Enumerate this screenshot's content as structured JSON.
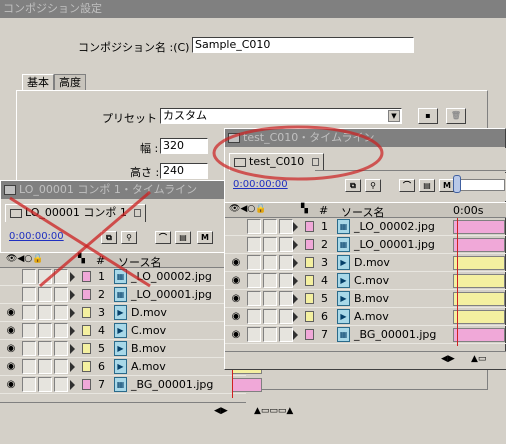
{
  "dialog": {
    "title": "コンポジション設定",
    "name_label": "コンポジション名 :(C)",
    "name_value": "Sample_C010",
    "tabs": [
      "基本",
      "高度"
    ],
    "preset_label": "プリセット :",
    "preset_value": "カスタム",
    "width_label": "幅 :",
    "width_value": "320",
    "height_label": "高さ :",
    "height_value": "240"
  },
  "timeline_front": {
    "title": "test_C010・タイムライン",
    "tab": "test_C010",
    "timecode": "0:00:00:00",
    "ruler_label": "0:00s",
    "col_number": "#",
    "col_source": "ソース名",
    "layers": [
      {
        "num": "1",
        "name": "_LO_00002.jpg",
        "color": "#f0a8d8",
        "type": "jpg",
        "visible": false
      },
      {
        "num": "2",
        "name": "_LO_00001.jpg",
        "color": "#f0a8d8",
        "type": "jpg",
        "visible": false
      },
      {
        "num": "3",
        "name": "D.mov",
        "color": "#f4f0a0",
        "type": "mov",
        "visible": true
      },
      {
        "num": "4",
        "name": "C.mov",
        "color": "#f4f0a0",
        "type": "mov",
        "visible": true
      },
      {
        "num": "5",
        "name": "B.mov",
        "color": "#f4f0a0",
        "type": "mov",
        "visible": true
      },
      {
        "num": "6",
        "name": "A.mov",
        "color": "#f4f0a0",
        "type": "mov",
        "visible": true
      },
      {
        "num": "7",
        "name": "_BG_00001.jpg",
        "color": "#f0a8d8",
        "type": "jpg",
        "visible": true
      }
    ]
  },
  "timeline_back": {
    "title": "LO_00001 コンポ 1・タイムライン",
    "tab": "LO_00001 コンポ 1",
    "timecode": "0:00:00:00",
    "col_number": "#",
    "col_source": "ソース名",
    "layers": [
      {
        "num": "1",
        "name": "_LO_00002.jpg",
        "color": "#f0a8d8",
        "type": "jpg",
        "visible": false
      },
      {
        "num": "2",
        "name": "_LO_00001.jpg",
        "color": "#f0a8d8",
        "type": "jpg",
        "visible": false
      },
      {
        "num": "3",
        "name": "D.mov",
        "color": "#f4f0a0",
        "type": "mov",
        "visible": true
      },
      {
        "num": "4",
        "name": "C.mov",
        "color": "#f4f0a0",
        "type": "mov",
        "visible": true
      },
      {
        "num": "5",
        "name": "B.mov",
        "color": "#f4f0a0",
        "type": "mov",
        "visible": true
      },
      {
        "num": "6",
        "name": "A.mov",
        "color": "#f4f0a0",
        "type": "mov",
        "visible": true
      },
      {
        "num": "7",
        "name": "_BG_00001.jpg",
        "color": "#f0a8d8",
        "type": "jpg",
        "visible": true
      }
    ]
  },
  "icons": {
    "eye": "eye-icon",
    "speaker": "speaker-icon",
    "solo": "solo-icon",
    "lock": "lock-icon",
    "label": "label-icon",
    "pointer": "pointer-icon"
  },
  "annotations": {
    "red_mark_color": "#cc2020"
  }
}
